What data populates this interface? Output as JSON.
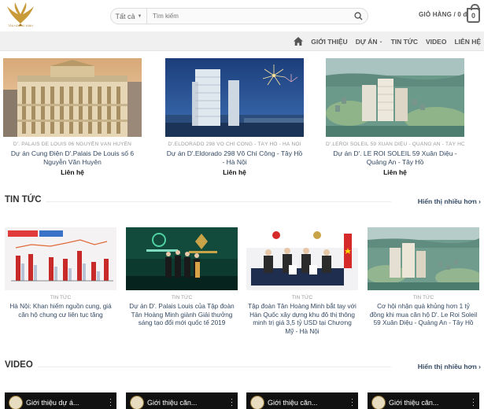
{
  "header": {
    "logo_text": "TÂN HOÀNG MINH",
    "search": {
      "category": "Tất cả",
      "placeholder": "Tìm kiếm"
    },
    "cart_label": "GIỎ HÀNG / 0 đ",
    "cart_count": "0"
  },
  "nav": {
    "items": [
      "GIỚI THIỆU",
      "DỰ ÁN",
      "TIN TỨC",
      "VIDEO",
      "LIÊN HỆ"
    ]
  },
  "products": [
    {
      "category": "D'. PALAIS DE LOUIS 06 NGUYỄN VĂN HUYÊN",
      "title": "Dự án Cung Điện D'.Palais De Louis số 6 Nguyễn Văn Huyên",
      "price": "Liên hệ"
    },
    {
      "category": "D'.ELDORADO 298 VÕ CHÍ CÔNG - TÂY HỒ - HÀ NỘI",
      "title": "Dự án D'.Eldorado 298 Võ Chí Công - Tây Hồ - Hà Nội",
      "price": "Liên hệ"
    },
    {
      "category": "D'.LEROI SOLEIL 59 XUÂN DIỆU - QUẢNG AN - TÂY HỒ",
      "title": "Dự án D'. LE ROI SOLEIL 59 Xuân Diệu - Quảng An - Tây Hồ",
      "price": "Liên hệ"
    }
  ],
  "news_section": {
    "title": "TIN TỨC",
    "more": "Hiển thị nhiều hơn",
    "items": [
      {
        "category": "TIN TỨC",
        "title": "Hà Nội: Khan hiếm nguồn cung, giá căn hộ chung cư liên tục tăng"
      },
      {
        "category": "TIN TỨC",
        "title": "Dự án D'. Palais Louis của Tập đoàn Tân Hoàng Minh giành Giải thưởng sáng tạo đổi mới quốc tế 2019"
      },
      {
        "category": "TIN TỨC",
        "title": "Tập đoàn Tân Hoàng Minh bắt tay với Hàn Quốc xây dựng khu đô thị thông minh trị giá 3,5 tỷ USD tại Chương Mỹ - Hà Nội"
      },
      {
        "category": "TIN TỨC",
        "title": "Cơ hội nhận quà khủng hơn 1 tỷ đồng khi mua căn hộ D'. Le Roi Soleil 59 Xuân Diệu - Quảng An - Tây Hồ"
      }
    ]
  },
  "video_section": {
    "title": "VIDEO",
    "more": "Hiển thị nhiều hơn",
    "items": [
      {
        "title": "Giới thiệu dự á..."
      },
      {
        "title": "Giới thiệu căn..."
      },
      {
        "title": "Giới thiệu căn..."
      },
      {
        "title": "Giới thiệu căn..."
      }
    ]
  },
  "colors": {
    "link": "#334862",
    "nav_bg": "#f0f0f0",
    "gold": "#b08a3e"
  }
}
